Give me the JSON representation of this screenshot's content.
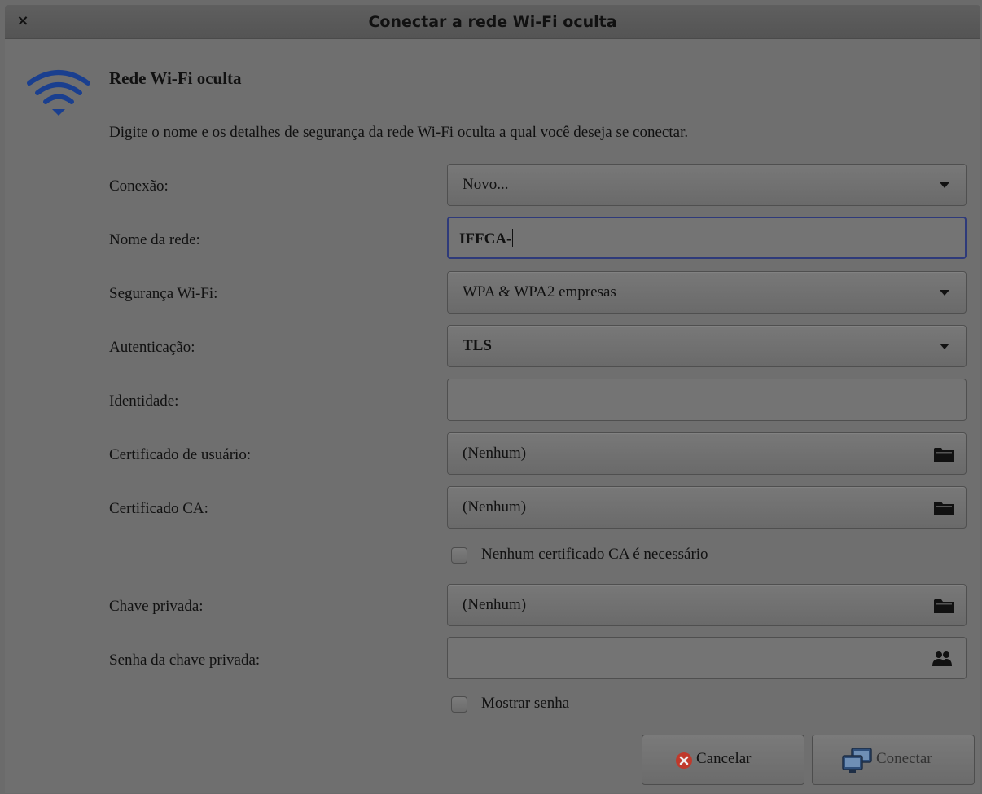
{
  "window": {
    "title": "Conectar a rede Wi-Fi oculta",
    "close_label": "×"
  },
  "header": {
    "icon": "wifi-icon",
    "title": "Rede Wi-Fi oculta",
    "description": "Digite o nome e os detalhes de segurança da rede Wi-Fi oculta a qual você deseja se conectar."
  },
  "form": {
    "connection": {
      "label": "Conexão:",
      "value": "Novo..."
    },
    "network_name": {
      "label": "Nome da rede:",
      "value": "IFFCA-"
    },
    "wifi_security": {
      "label": "Segurança Wi-Fi:",
      "value": "WPA & WPA2 empresas"
    },
    "authentication": {
      "label": "Autenticação:",
      "value": "TLS"
    },
    "identity": {
      "label": "Identidade:",
      "value": ""
    },
    "user_certificate": {
      "label": "Certificado de usuário:",
      "value": "(Nenhum)",
      "icon": "folder-icon"
    },
    "ca_certificate": {
      "label": "Certificado CA:",
      "value": "(Nenhum)",
      "icon": "folder-icon"
    },
    "no_ca_required": {
      "label": "Nenhum certificado CA é necessário",
      "checked": false
    },
    "private_key": {
      "label": "Chave privada:",
      "value": "(Nenhum)",
      "icon": "folder-icon"
    },
    "private_key_password": {
      "label": "Senha da chave privada:",
      "value": "",
      "icon": "people-icon"
    },
    "show_password": {
      "label": "Mostrar senha",
      "checked": false
    }
  },
  "buttons": {
    "cancel": {
      "label": "Cancelar",
      "icon": "cancel-icon"
    },
    "connect": {
      "label": "Conectar",
      "icon": "network-icon"
    }
  },
  "colors": {
    "focus_border": "#2e3a7a",
    "wifi_icon": "#1a3f8f",
    "cancel_icon": "#c0392b"
  }
}
